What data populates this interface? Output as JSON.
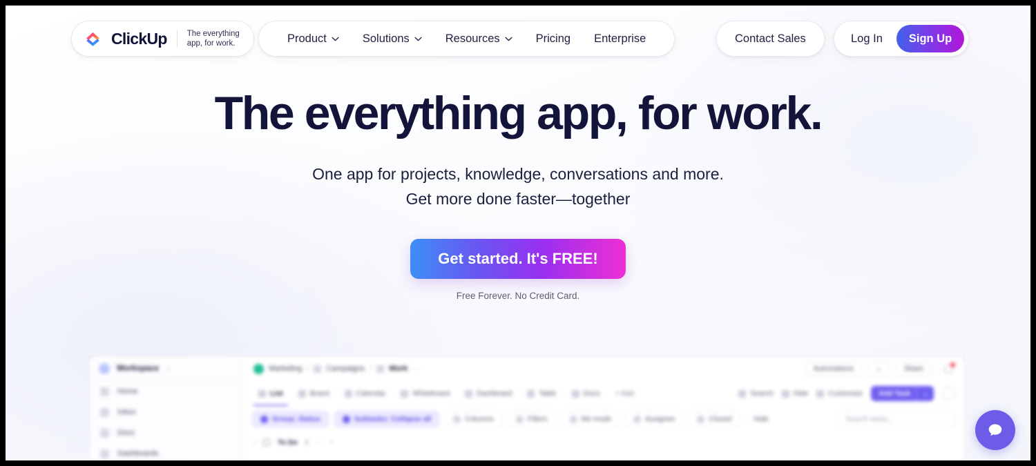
{
  "nav": {
    "logo": {
      "wordmark": "ClickUp",
      "tagline_line1": "The everything",
      "tagline_line2": "app, for work."
    },
    "menu": [
      {
        "label": "Product",
        "has_caret": true
      },
      {
        "label": "Solutions",
        "has_caret": true
      },
      {
        "label": "Resources",
        "has_caret": true
      },
      {
        "label": "Pricing",
        "has_caret": false
      },
      {
        "label": "Enterprise",
        "has_caret": false
      }
    ],
    "contact_sales": "Contact Sales",
    "log_in": "Log In",
    "sign_up": "Sign Up"
  },
  "hero": {
    "title": "The everything app, for work.",
    "subtitle_line1": "One app for projects, knowledge, conversations and more.",
    "subtitle_line2": "Get more done faster—together",
    "cta_label": "Get started. It's FREE!",
    "cta_note": "Free Forever. No Credit Card."
  },
  "preview": {
    "workspace": {
      "name": "Workspace",
      "caret": "⌄"
    },
    "sidebar_items": [
      {
        "label": "Home"
      },
      {
        "label": "Inbox"
      },
      {
        "label": "Docs"
      },
      {
        "label": "Dashboards"
      }
    ],
    "breadcrumb": {
      "space": "Marketing",
      "folder": "Campaigns",
      "list": "Work",
      "separator": "/",
      "overflow": "···"
    },
    "header_actions": [
      {
        "label": "Automations"
      },
      {
        "label": "⌄"
      },
      {
        "label": "Share"
      }
    ],
    "view_tabs": [
      {
        "label": "List",
        "active": true
      },
      {
        "label": "Board",
        "active": false
      },
      {
        "label": "Calendar",
        "active": false
      },
      {
        "label": "Whiteboard",
        "active": false
      },
      {
        "label": "Dashboard",
        "active": false
      },
      {
        "label": "Table",
        "active": false
      },
      {
        "label": "Docs",
        "active": false
      }
    ],
    "add_view_label": "+ Add",
    "toolbar": [
      {
        "label": "Search"
      },
      {
        "label": "Hide"
      },
      {
        "label": "Customize"
      }
    ],
    "add_task_label": "Add Task",
    "add_task_caret": "⌄",
    "filters": [
      {
        "label": "Group: Status",
        "accent": true
      },
      {
        "label": "Subtasks: Collapse all",
        "accent": true
      },
      {
        "label": "Columns",
        "accent": false
      },
      {
        "label": "Filters",
        "accent": false
      },
      {
        "label": "Me mode",
        "accent": false
      },
      {
        "label": "Assignee",
        "accent": false
      },
      {
        "label": "Closed",
        "accent": false
      },
      {
        "label": "Hide",
        "accent": false,
        "plain": true
      }
    ],
    "search_placeholder": "Search tasks...",
    "group_row": {
      "caret": "›",
      "name": "To Do",
      "count": "2",
      "overflow": "···",
      "add": "+"
    }
  },
  "chat": {
    "icon": "chat-bubble-icon"
  },
  "colors": {
    "brand_purple": "#7b68ee",
    "cta_gradient_start": "#3d8ef7",
    "cta_gradient_mid": "#9b2ff0",
    "cta_gradient_end": "#ee2fd4",
    "signup_gradient_start": "#4161e8",
    "signup_gradient_end": "#b317d8",
    "heading": "#12143a",
    "chat_bubble": "#6c5ce7",
    "notification_dot": "#fa3e5b"
  }
}
